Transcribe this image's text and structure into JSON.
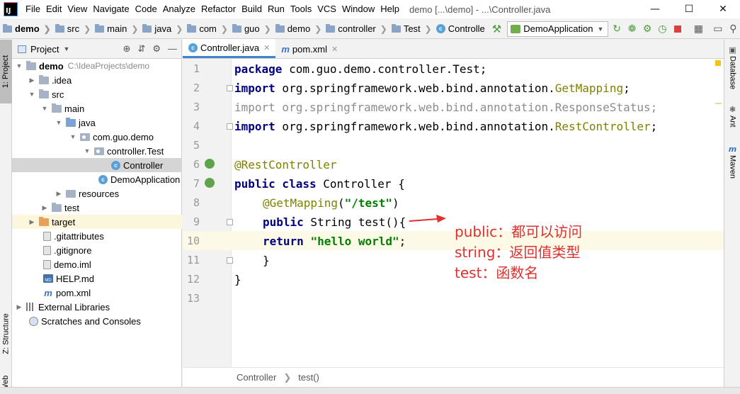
{
  "menubar": {
    "items": [
      "File",
      "Edit",
      "View",
      "Navigate",
      "Code",
      "Analyze",
      "Refactor",
      "Build",
      "Run",
      "Tools",
      "VCS",
      "Window",
      "Help"
    ],
    "title": "demo [...\\demo] - ...\\Controller.java"
  },
  "navbar": {
    "crumbs": [
      "demo",
      "src",
      "main",
      "java",
      "com",
      "guo",
      "demo",
      "controller",
      "Test",
      "Controlle"
    ],
    "run_config": "DemoApplication"
  },
  "left_strip": {
    "project_tab": "1: Project",
    "structure_tab": "Z: Structure",
    "web_tab": "Web"
  },
  "project_panel": {
    "title": "Project",
    "tree": [
      {
        "label": "demo",
        "hint": "C:\\IdeaProjects\\demo"
      },
      {
        "label": ".idea"
      },
      {
        "label": "src"
      },
      {
        "label": "main"
      },
      {
        "label": "java"
      },
      {
        "label": "com.guo.demo"
      },
      {
        "label": "controller.Test"
      },
      {
        "label": "Controller"
      },
      {
        "label": "DemoApplication"
      },
      {
        "label": "resources"
      },
      {
        "label": "test"
      },
      {
        "label": "target"
      },
      {
        "label": ".gitattributes"
      },
      {
        "label": ".gitignore"
      },
      {
        "label": "demo.iml"
      },
      {
        "label": "HELP.md"
      },
      {
        "label": "pom.xml"
      },
      {
        "label": "External Libraries"
      },
      {
        "label": "Scratches and Consoles"
      }
    ]
  },
  "editor": {
    "tabs": [
      {
        "label": "Controller.java"
      },
      {
        "label": "pom.xml"
      }
    ],
    "line_numbers": [
      "1",
      "2",
      "3",
      "4",
      "5",
      "6",
      "7",
      "8",
      "9",
      "10",
      "11",
      "12",
      "13"
    ],
    "code": {
      "l1_kw": "package",
      "l1_rest": " com.guo.demo.controller.Test;",
      "l2_kw": "import",
      "l2_rest": " org.springframework.web.bind.annotation.",
      "l2_ann": "GetMapping",
      "l2_end": ";",
      "l3": "import org.springframework.web.bind.annotation.ResponseStatus;",
      "l4_kw": "import",
      "l4_rest": " org.springframework.web.bind.annotation.",
      "l4_ann": "RestController",
      "l4_end": ";",
      "l6": "@RestController",
      "l7_kw": "public class",
      "l7_rest": " Controller {",
      "l8_ann": "@GetMapping",
      "l8_open": "(",
      "l8_str": "\"/test\"",
      "l8_close": ")",
      "l9_kw": "public",
      "l9_rest": " String test(){",
      "l10_kw": "return",
      "l10_str": "\"hello world\"",
      "l10_end": ";",
      "l11": "}",
      "l12": "}"
    },
    "breadcrumb": [
      "Controller",
      "test()"
    ]
  },
  "annotation": {
    "line1": "public：都可以访问",
    "line2": "string：返回值类型",
    "line3": "test：函数名"
  },
  "right_strip": {
    "database": "Database",
    "ant": "Ant",
    "maven": "Maven"
  }
}
